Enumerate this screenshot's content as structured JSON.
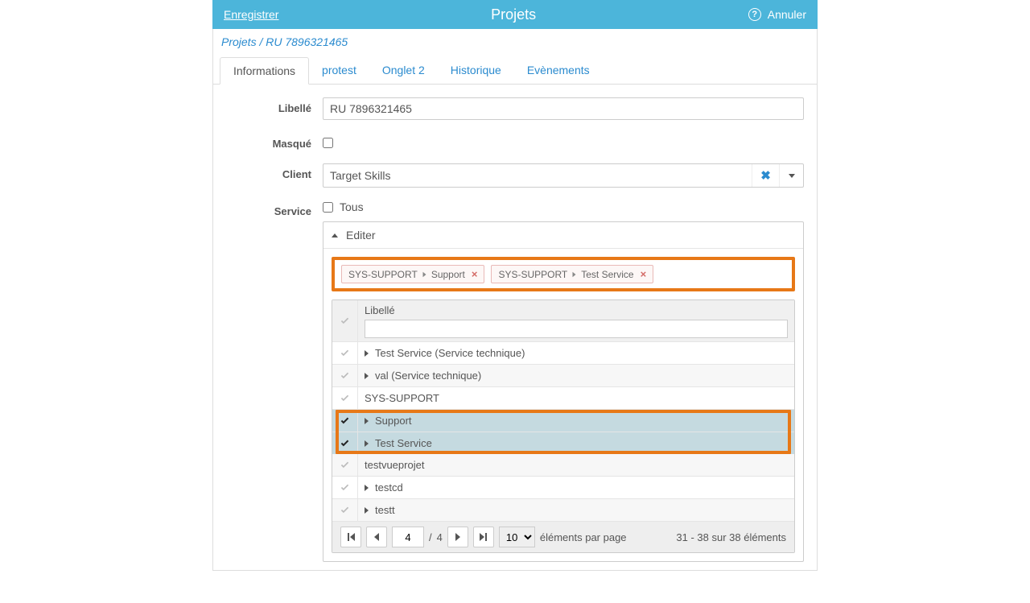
{
  "header": {
    "save": "Enregistrer",
    "title": "Projets",
    "cancel": "Annuler"
  },
  "breadcrumb": "Projets / RU 7896321465",
  "tabs": [
    {
      "label": "Informations"
    },
    {
      "label": "protest"
    },
    {
      "label": "Onglet 2"
    },
    {
      "label": "Historique"
    },
    {
      "label": "Evènements"
    }
  ],
  "form": {
    "libelle_label": "Libellé",
    "libelle_value": "RU 7896321465",
    "masque_label": "Masqué",
    "client_label": "Client",
    "client_value": "Target Skills",
    "service_label": "Service",
    "service_all_label": "Tous"
  },
  "editor": {
    "header": "Editer",
    "tags": [
      {
        "prefix": "SYS-SUPPORT",
        "name": "Support"
      },
      {
        "prefix": "SYS-SUPPORT",
        "name": "Test Service"
      }
    ],
    "column_header": "Libellé",
    "rows": [
      {
        "label": "Test Service (Service technique)",
        "checked": false,
        "child": true
      },
      {
        "label": "val (Service technique)",
        "checked": false,
        "child": true
      },
      {
        "label": "SYS-SUPPORT",
        "checked": false,
        "child": false
      },
      {
        "label": "Support",
        "checked": true,
        "child": true
      },
      {
        "label": "Test Service",
        "checked": true,
        "child": true
      },
      {
        "label": "testvueprojet",
        "checked": false,
        "child": false
      },
      {
        "label": "testcd",
        "checked": false,
        "child": true
      },
      {
        "label": "testt",
        "checked": false,
        "child": true
      }
    ]
  },
  "pager": {
    "page": "4",
    "total_pages": "4",
    "slash": "/",
    "page_size": "10",
    "per_page_label": "éléments par page",
    "status": "31 - 38 sur 38 éléments"
  }
}
